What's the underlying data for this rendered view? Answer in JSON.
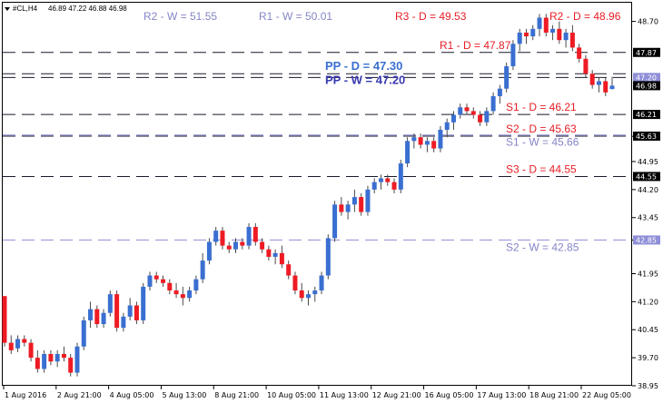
{
  "header": {
    "symbol": "#CL,H4",
    "ohlc": "46.89 47.22 46.88 46.98"
  },
  "colors": {
    "bull": "#3a6fd1",
    "bear": "#ee1b24",
    "daily_line": "#1a1a2e",
    "weekly_line": "#8f8fd8",
    "text_daily": "#e61e26",
    "text_weekly": "#8585c7",
    "pp_daily": "#3a6fd1",
    "pp_weekly": "#3a3ab0"
  },
  "chart_data": {
    "type": "candlestick",
    "title": "#CL,H4",
    "ylim": [
      38.95,
      49.2
    ],
    "grid": false,
    "y_ticks": [
      "48.71",
      "48.25",
      "47.78",
      "47.29",
      "46.75",
      "46.29",
      "45.81",
      "45.34",
      "44.87",
      "44.40",
      "43.93",
      "43.45",
      "42.98",
      "42.51",
      "42.04",
      "41.57",
      "41.10",
      "40.63",
      "40.16",
      "39.69",
      "39.22",
      "38.95"
    ],
    "y_tick_labels": [
      "48.70",
      "45.63",
      "44.95",
      "44.20",
      "43.45",
      "42.85",
      "41.95",
      "41.20",
      "40.45",
      "39.70",
      "38.95"
    ],
    "y_tick_values": [
      48.7,
      45.625,
      44.95,
      44.2,
      43.45,
      42.85,
      41.95,
      41.2,
      40.45,
      39.7,
      38.95
    ],
    "x_labels": [
      "1 Aug 2016",
      "2 Aug 21:00",
      "4 Aug 05:00",
      "5 Aug 13:00",
      "8 Aug 21:00",
      "10 Aug 05:00",
      "11 Aug 13:00",
      "12 Aug 21:00",
      "16 Aug 05:00",
      "17 Aug 13:00",
      "18 Aug 21:00",
      "22 Aug 05:00"
    ],
    "price_badges": [
      {
        "label": "47.87",
        "value": 47.87,
        "style": "dark"
      },
      {
        "label": "47.20",
        "value": 47.2,
        "style": "blue"
      },
      {
        "label": "46.98",
        "value": 46.98,
        "style": "dark"
      },
      {
        "label": "46.21",
        "value": 46.21,
        "style": "dark"
      },
      {
        "label": "45.63",
        "value": 45.63,
        "style": "dark"
      },
      {
        "label": "44.55",
        "value": 44.55,
        "style": "dark"
      },
      {
        "label": "42.85",
        "value": 42.85,
        "style": "blue"
      }
    ],
    "levels": [
      {
        "label": "R2 - W = 51.55",
        "group": "weekly",
        "value": null,
        "anchor": "top-left"
      },
      {
        "label": "R1 - W = 50.01",
        "group": "weekly",
        "value": null,
        "anchor": "top-mid"
      },
      {
        "label": "R3 - D = 49.53",
        "group": "daily",
        "value": null,
        "anchor": "top-right1"
      },
      {
        "label": "R2 - D = 48.96",
        "group": "daily",
        "value": null,
        "anchor": "top-right2"
      },
      {
        "label": "R1 - D = 47.87",
        "group": "daily",
        "value": 47.87,
        "anchor": "line"
      },
      {
        "label": "PP - D = 47.30",
        "group": "pp_daily",
        "value": 47.3,
        "anchor": "line"
      },
      {
        "label": "PP - W = 47.20",
        "group": "pp_weekly",
        "value": 47.2,
        "anchor": "line"
      },
      {
        "label": "S1 - D = 46.21",
        "group": "daily",
        "value": 46.21,
        "anchor": "line"
      },
      {
        "label": "S2 - D = 45.63",
        "group": "daily",
        "value": 45.63,
        "anchor": "line"
      },
      {
        "label": "S1 - W = 45.66",
        "group": "weekly",
        "value": 45.66,
        "anchor": "line"
      },
      {
        "label": "S3 - D = 44.55",
        "group": "daily",
        "value": 44.55,
        "anchor": "line"
      },
      {
        "label": "S2 - W = 42.85",
        "group": "weekly",
        "value": 42.85,
        "anchor": "line"
      }
    ],
    "candles": [
      [
        41.35,
        41.2,
        40.0,
        40.1
      ],
      [
        40.1,
        40.3,
        39.8,
        39.9
      ],
      [
        39.95,
        40.3,
        39.85,
        40.2
      ],
      [
        40.2,
        40.3,
        40.0,
        40.1
      ],
      [
        40.1,
        40.2,
        39.6,
        39.7
      ],
      [
        39.7,
        39.9,
        39.3,
        39.4
      ],
      [
        39.4,
        39.9,
        39.3,
        39.8
      ],
      [
        39.8,
        39.9,
        39.5,
        39.6
      ],
      [
        39.6,
        39.9,
        39.45,
        39.8
      ],
      [
        39.8,
        40.0,
        39.6,
        39.7
      ],
      [
        39.7,
        39.8,
        39.2,
        39.3
      ],
      [
        39.3,
        40.1,
        39.2,
        40.0
      ],
      [
        40.0,
        40.8,
        39.9,
        40.7
      ],
      [
        40.7,
        41.2,
        40.5,
        41.0
      ],
      [
        41.0,
        41.1,
        40.5,
        40.6
      ],
      [
        40.6,
        41.0,
        40.5,
        40.9
      ],
      [
        40.9,
        41.5,
        40.8,
        41.4
      ],
      [
        41.4,
        41.5,
        40.4,
        40.5
      ],
      [
        40.5,
        40.9,
        40.4,
        40.8
      ],
      [
        40.8,
        41.3,
        40.7,
        41.1
      ],
      [
        41.1,
        41.2,
        40.6,
        40.7
      ],
      [
        40.7,
        41.7,
        40.6,
        41.6
      ],
      [
        41.6,
        42.0,
        41.5,
        41.9
      ],
      [
        41.9,
        42.0,
        41.7,
        41.8
      ],
      [
        41.8,
        41.9,
        41.6,
        41.7
      ],
      [
        41.7,
        41.8,
        41.4,
        41.5
      ],
      [
        41.5,
        41.7,
        41.3,
        41.4
      ],
      [
        41.4,
        41.6,
        41.1,
        41.3
      ],
      [
        41.3,
        41.6,
        41.2,
        41.5
      ],
      [
        41.5,
        41.9,
        41.4,
        41.8
      ],
      [
        41.8,
        42.5,
        41.7,
        42.3
      ],
      [
        42.3,
        42.9,
        42.2,
        42.8
      ],
      [
        42.8,
        43.2,
        42.7,
        43.1
      ],
      [
        43.1,
        43.2,
        42.6,
        42.7
      ],
      [
        42.7,
        42.8,
        42.5,
        42.6
      ],
      [
        42.6,
        42.9,
        42.5,
        42.8
      ],
      [
        42.8,
        42.9,
        42.6,
        42.7
      ],
      [
        42.7,
        43.3,
        42.6,
        43.2
      ],
      [
        43.2,
        43.3,
        42.7,
        42.8
      ],
      [
        42.8,
        42.9,
        42.5,
        42.6
      ],
      [
        42.6,
        42.7,
        42.3,
        42.4
      ],
      [
        42.4,
        42.6,
        42.2,
        42.5
      ],
      [
        42.5,
        42.7,
        42.1,
        42.2
      ],
      [
        42.2,
        42.3,
        41.8,
        41.9
      ],
      [
        41.9,
        42.0,
        41.4,
        41.5
      ],
      [
        41.5,
        41.7,
        41.2,
        41.3
      ],
      [
        41.3,
        41.5,
        41.1,
        41.4
      ],
      [
        41.4,
        41.6,
        41.2,
        41.5
      ],
      [
        41.5,
        42.0,
        41.4,
        41.9
      ],
      [
        41.9,
        43.0,
        41.8,
        42.9
      ],
      [
        42.9,
        43.9,
        42.8,
        43.8
      ],
      [
        43.8,
        44.0,
        43.5,
        43.6
      ],
      [
        43.6,
        43.9,
        43.4,
        43.8
      ],
      [
        43.8,
        44.2,
        43.6,
        44.0
      ],
      [
        44.0,
        44.1,
        43.5,
        43.6
      ],
      [
        43.6,
        44.3,
        43.5,
        44.2
      ],
      [
        44.2,
        44.5,
        44.1,
        44.4
      ],
      [
        44.4,
        44.6,
        44.2,
        44.5
      ],
      [
        44.5,
        44.6,
        44.3,
        44.4
      ],
      [
        44.4,
        44.5,
        44.1,
        44.2
      ],
      [
        44.2,
        45.0,
        44.1,
        44.9
      ],
      [
        44.9,
        45.6,
        44.8,
        45.5
      ],
      [
        45.5,
        45.7,
        45.3,
        45.6
      ],
      [
        45.6,
        45.7,
        45.3,
        45.4
      ],
      [
        45.4,
        45.6,
        45.2,
        45.5
      ],
      [
        45.5,
        45.6,
        45.2,
        45.3
      ],
      [
        45.3,
        45.9,
        45.2,
        45.8
      ],
      [
        45.8,
        46.1,
        45.6,
        46.0
      ],
      [
        46.0,
        46.3,
        45.8,
        46.2
      ],
      [
        46.2,
        46.5,
        46.1,
        46.4
      ],
      [
        46.4,
        46.5,
        46.2,
        46.3
      ],
      [
        46.3,
        46.4,
        46.1,
        46.2
      ],
      [
        46.2,
        46.3,
        45.9,
        46.0
      ],
      [
        46.0,
        46.4,
        45.9,
        46.3
      ],
      [
        46.3,
        46.8,
        46.2,
        46.7
      ],
      [
        46.7,
        47.0,
        46.5,
        46.9
      ],
      [
        46.9,
        47.6,
        46.8,
        47.5
      ],
      [
        47.5,
        48.2,
        47.4,
        48.1
      ],
      [
        48.1,
        48.5,
        47.9,
        48.4
      ],
      [
        48.4,
        48.5,
        48.1,
        48.3
      ],
      [
        48.3,
        48.6,
        48.2,
        48.5
      ],
      [
        48.5,
        48.9,
        48.3,
        48.8
      ],
      [
        48.8,
        48.9,
        48.3,
        48.4
      ],
      [
        48.4,
        48.6,
        48.2,
        48.5
      ],
      [
        48.5,
        48.7,
        48.1,
        48.2
      ],
      [
        48.2,
        48.5,
        48.0,
        48.4
      ],
      [
        48.4,
        48.6,
        47.9,
        48.0
      ],
      [
        48.0,
        48.1,
        47.6,
        47.7
      ],
      [
        47.7,
        47.8,
        47.2,
        47.3
      ],
      [
        47.3,
        47.4,
        46.9,
        47.0
      ],
      [
        47.0,
        47.2,
        46.8,
        47.1
      ],
      [
        47.1,
        47.2,
        46.7,
        46.8
      ],
      [
        46.89,
        47.22,
        46.88,
        46.98
      ]
    ]
  }
}
